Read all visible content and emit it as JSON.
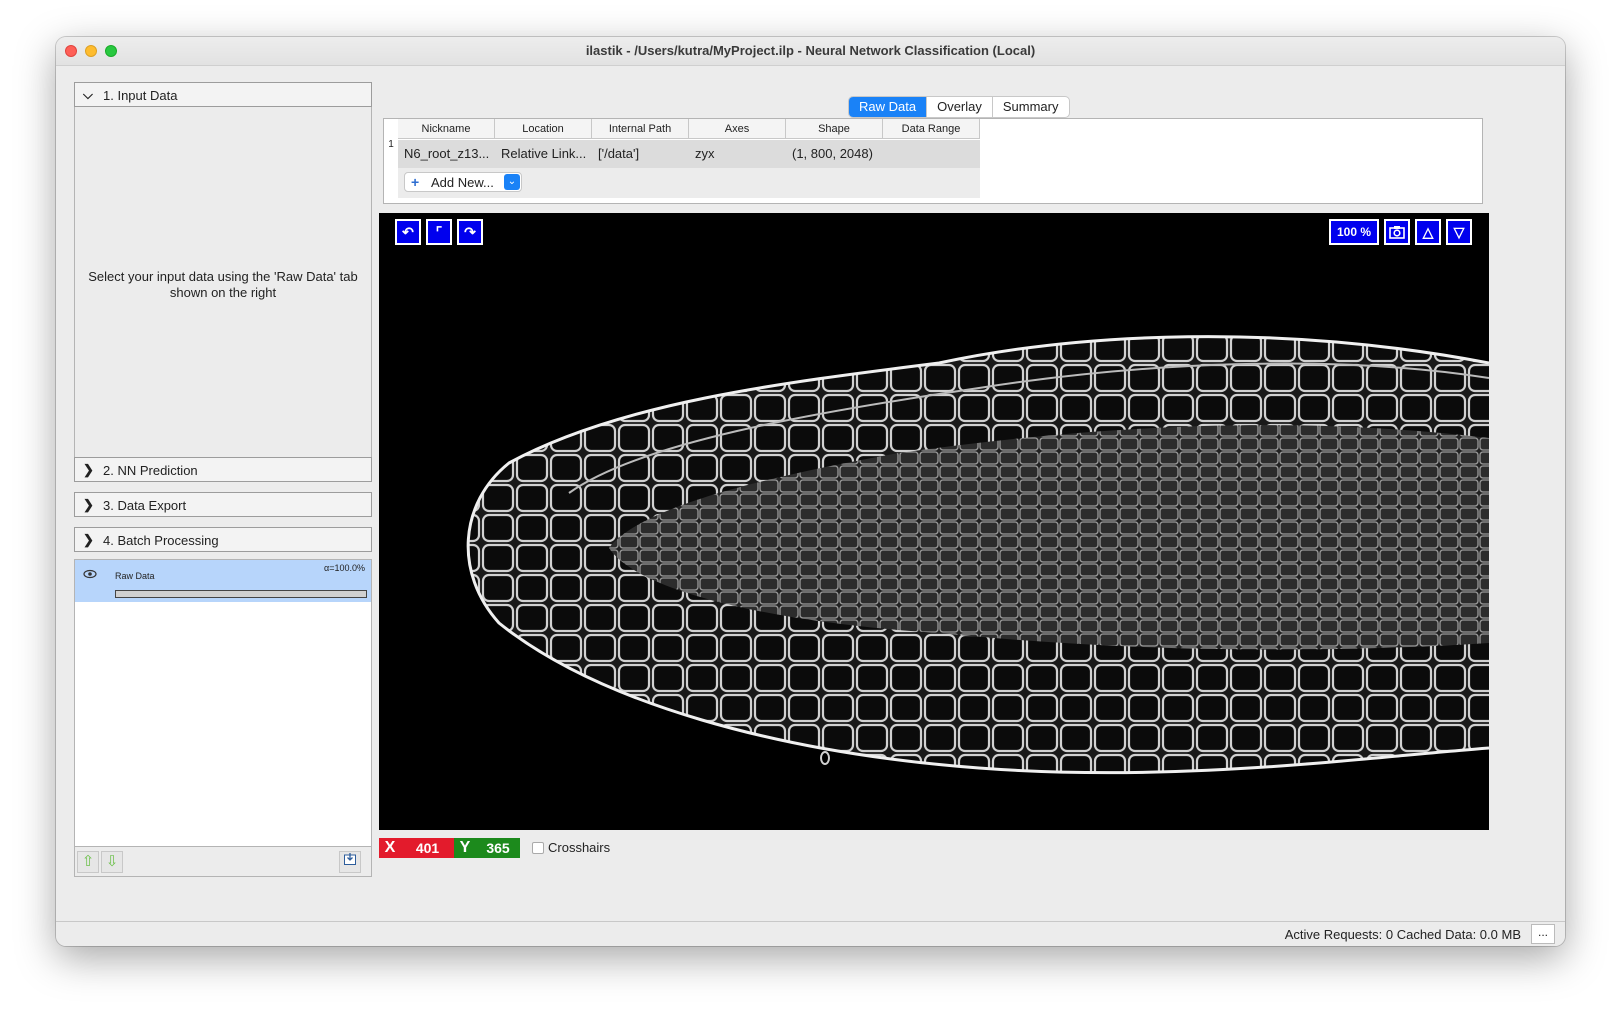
{
  "window": {
    "title": "ilastik - /Users/kutra/MyProject.ilp - Neural Network Classification (Local)"
  },
  "applets": [
    {
      "label": "1. Input Data",
      "expanded": true
    },
    {
      "label": "2. NN Prediction",
      "expanded": false
    },
    {
      "label": "3. Data Export",
      "expanded": false
    },
    {
      "label": "4. Batch Processing",
      "expanded": false
    }
  ],
  "applet_message": "Select your input data using the 'Raw Data' tab shown on the right",
  "layers": [
    {
      "name": "Raw Data",
      "alpha": "α=100.0%"
    }
  ],
  "tabs": [
    "Raw Data",
    "Overlay",
    "Summary"
  ],
  "active_tab": "Raw Data",
  "table": {
    "columns": [
      "Nickname",
      "Location",
      "Internal Path",
      "Axes",
      "Shape",
      "Data Range"
    ],
    "rows": [
      {
        "index": "1",
        "cells": [
          "N6_root_z13...",
          "Relative Link...",
          "['/data']",
          "zyx",
          "(1, 800, 2048)",
          ""
        ]
      }
    ],
    "add_new_label": "Add New..."
  },
  "viewer": {
    "zoom": "100 %",
    "x_label": "X",
    "x_value": "401",
    "y_label": "Y",
    "y_value": "365",
    "crosshairs_label": "Crosshairs",
    "crosshairs_checked": false
  },
  "status": {
    "text": "Active Requests: 0  Cached Data: 0.0 MB",
    "button_label": "..."
  },
  "colors": {
    "tab_active": "#1a82f7",
    "viewer_button": "#0000ee",
    "x_badge": "#e31b2c",
    "y_badge": "#1c8a1c",
    "layer_selected": "#b7d5fb"
  }
}
